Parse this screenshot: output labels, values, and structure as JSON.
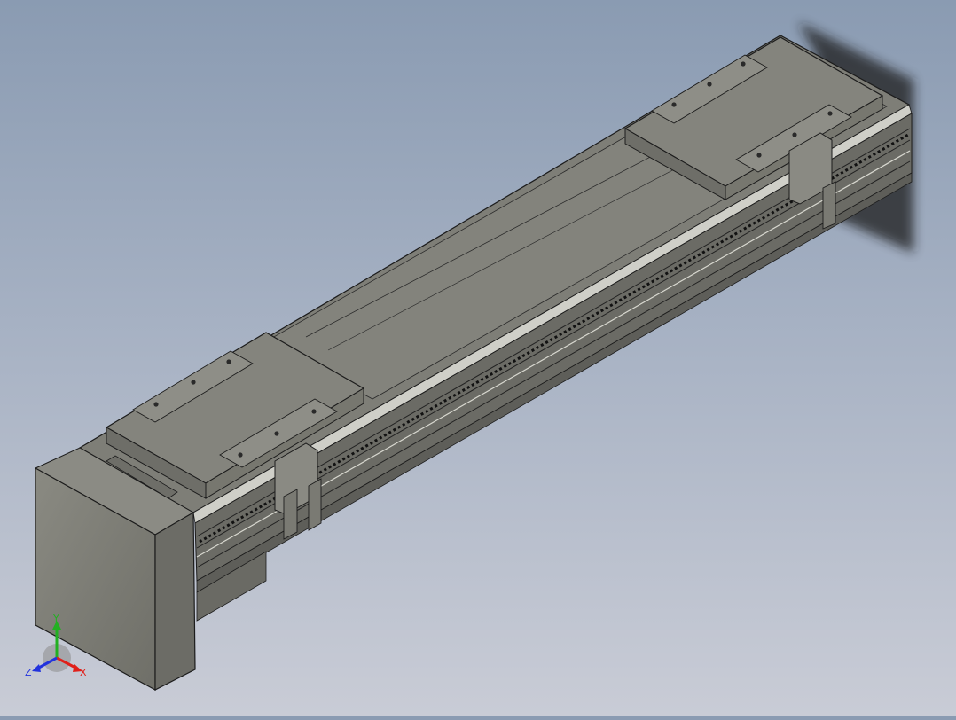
{
  "viewport": {
    "model": "linear-actuator-assembly",
    "background_top": "#8a9bb2",
    "background_bottom": "#c9ccd6",
    "body_color": "#7f7f78",
    "edge_color": "#1c1c1c"
  },
  "triad": {
    "x_label": "X",
    "y_label": "Y",
    "z_label": "Z",
    "x_color": "#e0201a",
    "y_color": "#22b022",
    "z_color": "#2233dd"
  }
}
